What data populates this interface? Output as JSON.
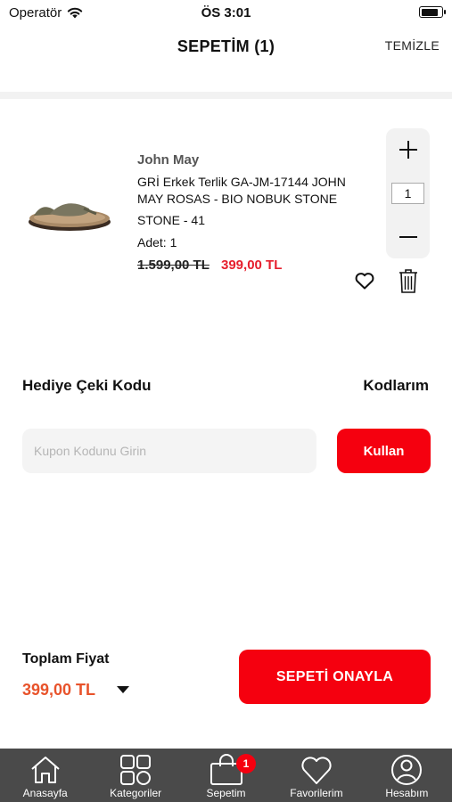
{
  "status_bar": {
    "carrier": "Operatör",
    "time": "ÖS 3:01",
    "battery_level": 0.9
  },
  "header": {
    "title": "SEPETİM  (1)",
    "clear_label": "TEMİZLE"
  },
  "cart": {
    "items": [
      {
        "brand": "John May",
        "name": "GRİ Erkek Terlik GA-JM-17144 JOHN MAY ROSAS - BIO NOBUK STONE",
        "variant": "STONE - 41",
        "quantity_text": "Adet:  1",
        "quantity": "1",
        "old_price": "1.599,00 TL",
        "new_price": "399,00 TL"
      }
    ]
  },
  "gift": {
    "title": "Hediye Çeki Kodu",
    "my_codes_label": "Kodlarım",
    "placeholder": "Kupon Kodunu Girin",
    "apply_label": "Kullan"
  },
  "total": {
    "label": "Toplam Fiyat",
    "value": "399,00 TL",
    "confirm_label": "SEPETİ ONAYLA"
  },
  "tabbar": {
    "tabs": [
      {
        "label": "Anasayfa",
        "icon": "home-icon"
      },
      {
        "label": "Kategoriler",
        "icon": "grid-icon"
      },
      {
        "label": "Sepetim",
        "icon": "bag-icon"
      },
      {
        "label": "Favorilerim",
        "icon": "heart-icon"
      },
      {
        "label": "Hesabım",
        "icon": "user-icon"
      }
    ],
    "cart_badge": "1"
  },
  "colors": {
    "accent": "#f5000f",
    "price": "#e61e2d",
    "total": "#e8532b",
    "tabbar": "#4a4a4a"
  }
}
